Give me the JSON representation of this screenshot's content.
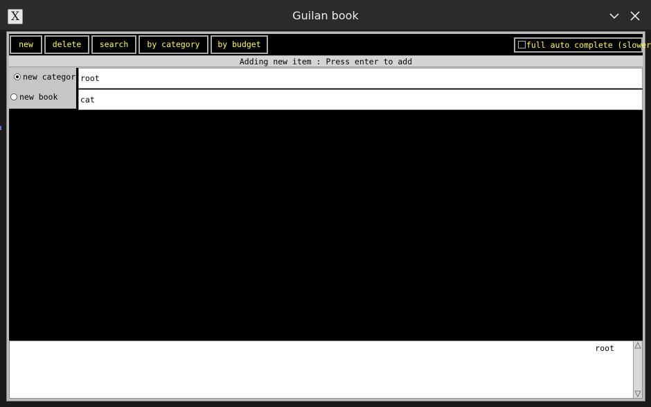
{
  "window": {
    "title": "Guilan book",
    "icon": "x-app-icon",
    "icon_glyph": "X"
  },
  "toolbar": {
    "buttons": [
      {
        "label": "new"
      },
      {
        "label": "delete"
      },
      {
        "label": "search"
      },
      {
        "label": "by category"
      },
      {
        "label": "by budget"
      }
    ],
    "auto_complete": {
      "label": "full auto complete (slower)",
      "checked": false
    }
  },
  "status": "Adding new item : Press enter to add",
  "form": {
    "radio_options": [
      {
        "label": "new category",
        "selected": true
      },
      {
        "label": "new book",
        "selected": false
      }
    ],
    "fields": [
      {
        "value": "root"
      },
      {
        "value": "cat"
      }
    ]
  },
  "output": {
    "text": "root"
  },
  "colors": {
    "button_text": "#ffff40",
    "background": "#000000",
    "panel": "#c6c6c6"
  }
}
